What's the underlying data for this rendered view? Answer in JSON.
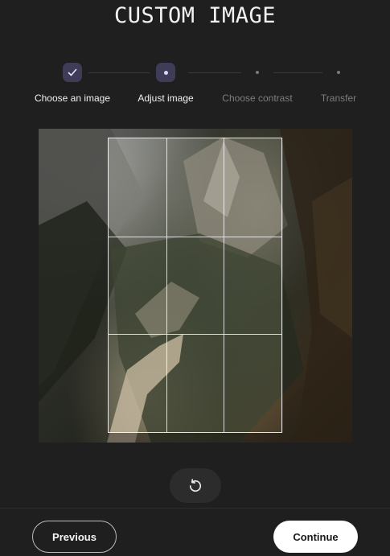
{
  "header": {
    "title": "CUSTOM IMAGE"
  },
  "stepper": {
    "steps": [
      {
        "label": "Choose an image",
        "state": "done",
        "icon": "check-icon"
      },
      {
        "label": "Adjust image",
        "state": "active"
      },
      {
        "label": "Choose contrast",
        "state": "pending"
      },
      {
        "label": "Transfer",
        "state": "pending"
      }
    ]
  },
  "editor": {
    "image": "mountain-trail-photo",
    "reset_icon": "rotate-ccw-icon"
  },
  "footer": {
    "previous_label": "Previous",
    "continue_label": "Continue"
  },
  "colors": {
    "background": "#1f1f1f",
    "step_active": "#3e3c56",
    "primary_button": "#ffffff"
  }
}
